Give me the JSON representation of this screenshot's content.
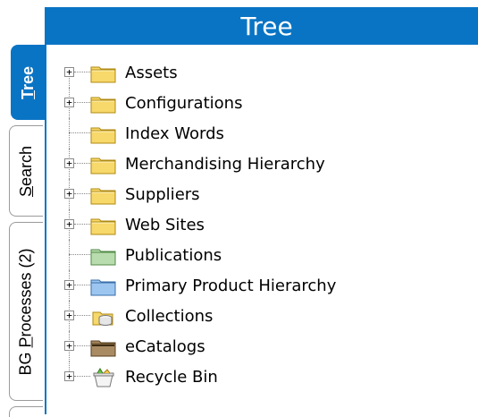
{
  "header": {
    "title": "Tree"
  },
  "tabs": [
    {
      "label_pre": "",
      "label_u": "T",
      "label_post": "ree",
      "active": true
    },
    {
      "label_pre": "",
      "label_u": "S",
      "label_post": "earch",
      "active": false
    },
    {
      "label_pre": "BG ",
      "label_u": "P",
      "label_post": "rocesses (2)",
      "active": false
    }
  ],
  "tree": {
    "items": [
      {
        "label": "Assets",
        "icon": "folder-yellow-icon",
        "expandable": true
      },
      {
        "label": "Configurations",
        "icon": "folder-yellow-icon",
        "expandable": true
      },
      {
        "label": "Index Words",
        "icon": "folder-yellow-icon",
        "expandable": false
      },
      {
        "label": "Merchandising Hierarchy",
        "icon": "folder-yellow-icon",
        "expandable": true
      },
      {
        "label": "Suppliers",
        "icon": "folder-yellow-icon",
        "expandable": true
      },
      {
        "label": "Web Sites",
        "icon": "folder-yellow-icon",
        "expandable": true
      },
      {
        "label": "Publications",
        "icon": "folder-green-icon",
        "expandable": false
      },
      {
        "label": "Primary Product Hierarchy",
        "icon": "folder-blue-icon",
        "expandable": true
      },
      {
        "label": "Collections",
        "icon": "collections-icon",
        "expandable": true
      },
      {
        "label": "eCatalogs",
        "icon": "folder-brown-icon",
        "expandable": true
      },
      {
        "label": "Recycle Bin",
        "icon": "recycle-bin-icon",
        "expandable": true
      }
    ]
  },
  "colors": {
    "accent": "#0a74c4",
    "folder_yellow": "#f7d86a",
    "folder_green": "#b9dcae",
    "folder_blue": "#9cc6f0",
    "folder_brown": "#a98b63"
  }
}
